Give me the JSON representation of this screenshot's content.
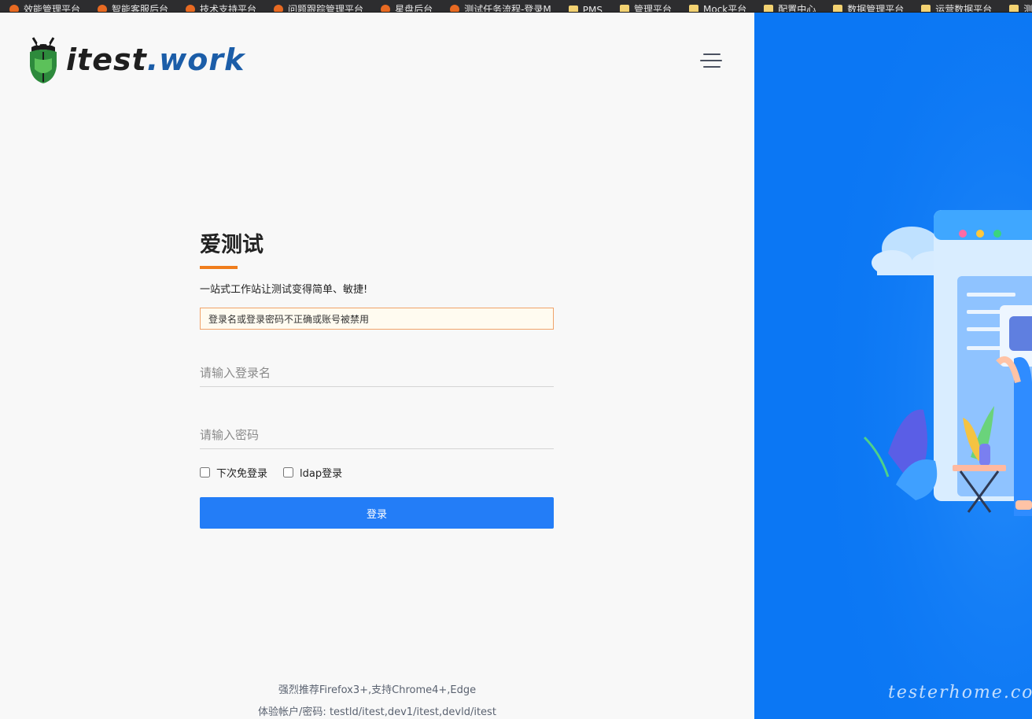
{
  "bookmarks": [
    {
      "label": "效能管理平台",
      "icon": "fav"
    },
    {
      "label": "智能客服后台",
      "icon": "fav"
    },
    {
      "label": "技术支持平台",
      "icon": "fav"
    },
    {
      "label": "问题跟踪管理平台",
      "icon": "fav"
    },
    {
      "label": "星盘后台",
      "icon": "fav"
    },
    {
      "label": "测试任务流程-登录M",
      "icon": "fav"
    },
    {
      "label": "PMS",
      "icon": "folder"
    },
    {
      "label": "管理平台",
      "icon": "folder"
    },
    {
      "label": "Mock平台",
      "icon": "folder"
    },
    {
      "label": "配置中心",
      "icon": "folder"
    },
    {
      "label": "数据管理平台",
      "icon": "folder"
    },
    {
      "label": "运营数据平台",
      "icon": "folder"
    },
    {
      "label": "测试",
      "icon": "folder"
    }
  ],
  "brand": {
    "name_main": "itest",
    "name_dot": ".work"
  },
  "login": {
    "title": "爱测试",
    "subtitle": "一站式工作站让测试变得简单、敏捷!",
    "error": "登录名或登录密码不正确或账号被禁用",
    "username_placeholder": "请输入登录名",
    "password_placeholder": "请输入密码",
    "remember_label": "下次免登录",
    "ldap_label": "ldap登录",
    "submit_label": "登录"
  },
  "footer": {
    "line1": "强烈推荐Firefox3+,支持Chrome4+,Edge",
    "line2": "体验帐户/密码: testld/itest,dev1/itest,devld/itest"
  },
  "watermark": "testerhome.com",
  "colors": {
    "accent_blue": "#237df7",
    "panel_blue": "#0b77f4",
    "underline_orange": "#f07d1c",
    "error_border": "#f0a36a"
  }
}
